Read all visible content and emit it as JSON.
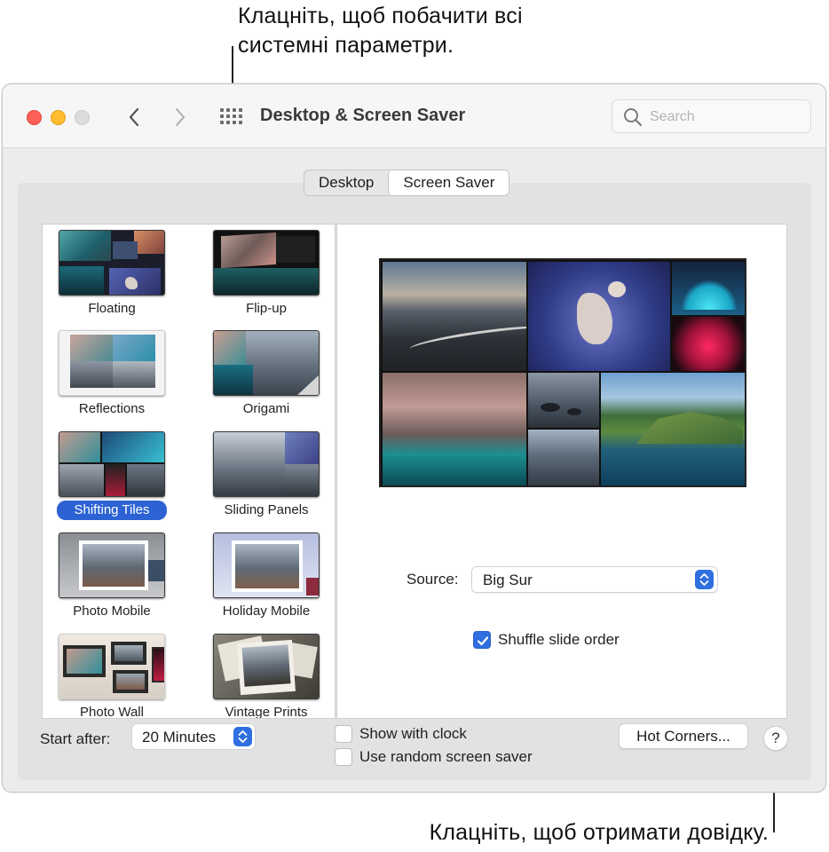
{
  "callouts": {
    "top_line1": "Клацніть, щоб побачити всі",
    "top_line2": "системні параметри.",
    "bottom": "Клацніть, щоб отримати довідку."
  },
  "window": {
    "title": "Desktop & Screen Saver",
    "traffic_colors": {
      "close": "#fe5f57",
      "minimize": "#febc2e",
      "zoom": "#dcdcdc"
    },
    "icons": {
      "back": "chevron-left-icon",
      "forward": "chevron-right-icon",
      "show_all": "grid-icon",
      "search": "magnifier-icon"
    }
  },
  "search": {
    "placeholder": "Search"
  },
  "tabs": [
    {
      "label": "Desktop",
      "active": false
    },
    {
      "label": "Screen Saver",
      "active": true
    }
  ],
  "screen_savers": [
    {
      "label": "Floating",
      "selected": false
    },
    {
      "label": "Flip-up",
      "selected": false
    },
    {
      "label": "Reflections",
      "selected": false
    },
    {
      "label": "Origami",
      "selected": false
    },
    {
      "label": "Shifting Tiles",
      "selected": true
    },
    {
      "label": "Sliding Panels",
      "selected": false
    },
    {
      "label": "Photo Mobile",
      "selected": false
    },
    {
      "label": "Holiday Mobile",
      "selected": false
    },
    {
      "label": "Photo Wall",
      "selected": false
    },
    {
      "label": "Vintage Prints",
      "selected": false
    }
  ],
  "options": {
    "source_label": "Source:",
    "source_value": "Big Sur",
    "shuffle_label": "Shuffle slide order",
    "shuffle_checked": true
  },
  "footer": {
    "start_after_label": "Start after:",
    "start_after_value": "20 Minutes",
    "show_clock_label": "Show with clock",
    "show_clock_checked": false,
    "random_label": "Use random screen saver",
    "random_checked": false,
    "hot_corners_label": "Hot Corners...",
    "help_label": "?"
  },
  "accent_color": "#2f6fe0",
  "selection_color": "#2c62d3"
}
